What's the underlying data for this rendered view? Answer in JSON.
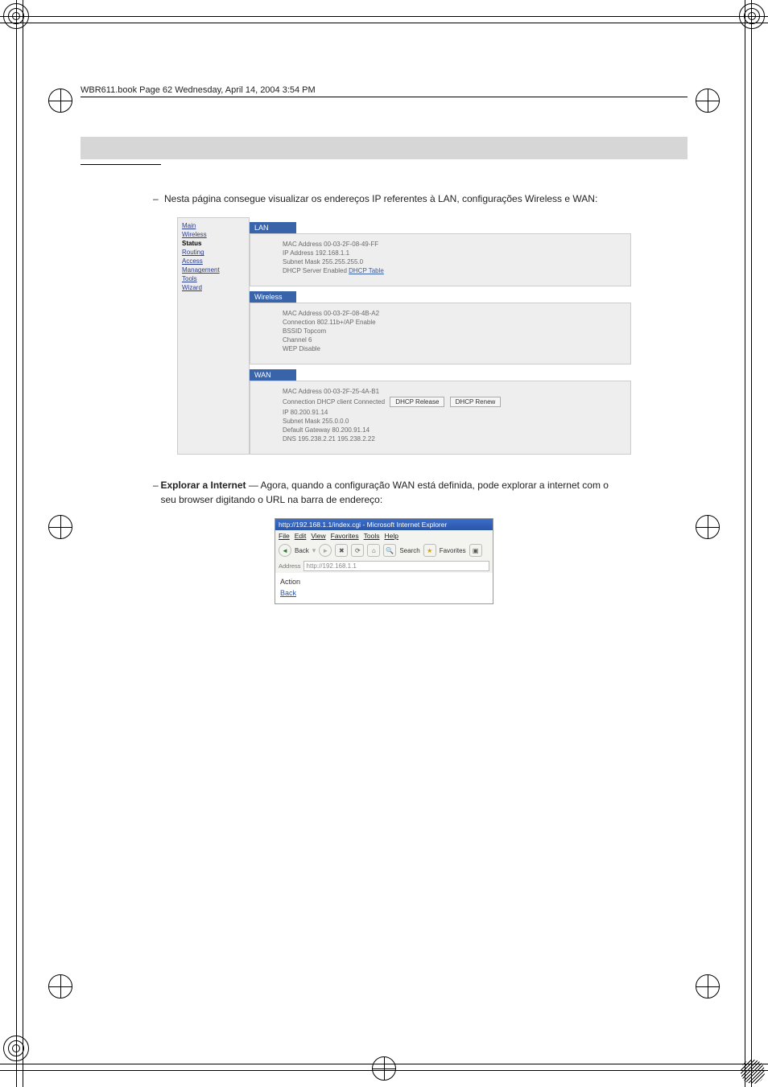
{
  "page_header": "WBR611.book  Page 62  Wednesday, April 14, 2004  3:54 PM",
  "sidebar": {
    "items": [
      {
        "label": "Main"
      },
      {
        "label": "Wireless"
      },
      {
        "label": "Status"
      },
      {
        "label": "Routing"
      },
      {
        "label": "Access"
      },
      {
        "label": "Management"
      },
      {
        "label": "Tools"
      },
      {
        "label": "Wizard"
      }
    ],
    "selected": "Status"
  },
  "status": {
    "lan": {
      "title": "LAN",
      "mac_label": "MAC Address",
      "mac_value": "00-03-2F-08-49-FF",
      "ip_label": "IP Address",
      "ip_value": "192.168.1.1",
      "subnet_label": "Subnet Mask",
      "subnet_value": "255.255.255.0",
      "dhcp_label": "DHCP Server Enabled",
      "dhcp_link": "DHCP Table"
    },
    "wireless": {
      "title": "Wireless",
      "mac_label": "MAC Address",
      "mac_value": "00-03-2F-08-4B-A2",
      "conn_label": "Connection",
      "conn_value": "802.11b+/AP Enable",
      "bssid_label": "BSSID",
      "bssid_value": "Topcom",
      "channel_label": "Channel",
      "channel_value": "6",
      "wep_label": "WEP",
      "wep_value": "Disable"
    },
    "wan": {
      "title": "WAN",
      "mac_label": "MAC Address",
      "mac_value": "00-03-2F-25-4A-B1",
      "conn_label": "Connection",
      "conn_value": "DHCP client Connected",
      "btn_release": "DHCP Release",
      "btn_renew": "DHCP Renew",
      "ip_label": "IP",
      "ip_value": "80.200.91.14",
      "subnet_label": "Subnet Mask",
      "subnet_value": "255.0.0.0",
      "gw_label": "Default Gateway",
      "gw_value": "80.200.91.14",
      "dns_label": "DNS",
      "dns_value": "195.238.2.21  195.238.2.22"
    }
  },
  "body": {
    "p1": "Nesta página consegue visualizar os endereços IP referentes à LAN, configurações Wireless e WAN:",
    "p2_head": "Explorar a Internet",
    "p2_tail": " — Agora, quando a configuração WAN está definida, pode explorar a internet com o seu browser digitando o URL na barra de endereço:"
  },
  "bullet": {
    "p1": "–",
    "p2": "–"
  },
  "ie": {
    "title_left": "http://192.168.1.1/index.cgi - Microsoft Internet Explorer",
    "menu": {
      "file": "File",
      "edit": "Edit",
      "view": "View",
      "fav": "Favorites",
      "tools": "Tools",
      "help": "Help"
    },
    "back": "Back",
    "search": "Search",
    "favorites": "Favorites",
    "addr_label": "Address",
    "addr_value": "http://192.168.1.1",
    "link_label": "Action",
    "back_label": "Back"
  }
}
